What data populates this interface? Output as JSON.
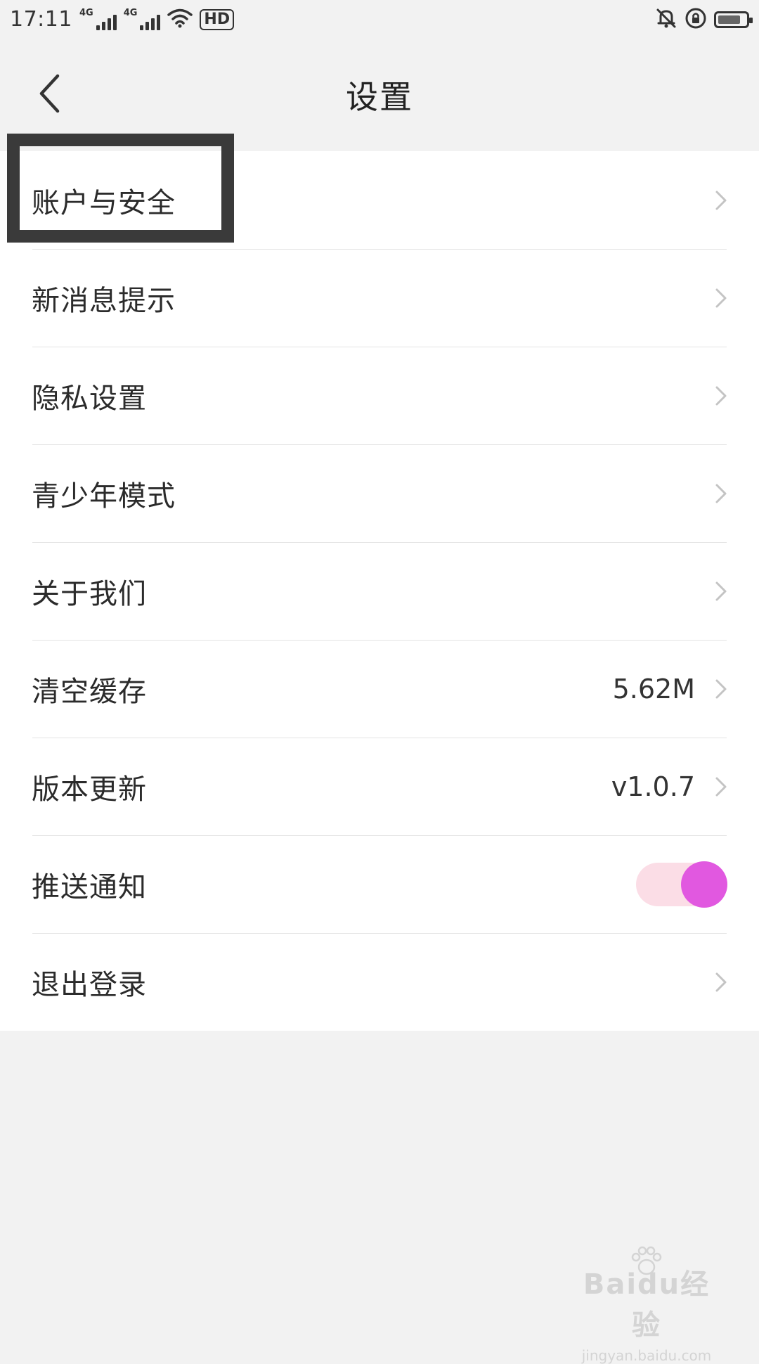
{
  "status_bar": {
    "time": "17:11",
    "network_1": "4G",
    "network_2": "4G",
    "hd_label": "HD",
    "battery_level": 0.7
  },
  "header": {
    "title": "设置",
    "back_icon": "chevron-left-icon"
  },
  "settings": {
    "items": [
      {
        "label": "账户与安全",
        "value": "",
        "type": "link"
      },
      {
        "label": "新消息提示",
        "value": "",
        "type": "link"
      },
      {
        "label": "隐私设置",
        "value": "",
        "type": "link"
      },
      {
        "label": "青少年模式",
        "value": "",
        "type": "link"
      },
      {
        "label": "关于我们",
        "value": "",
        "type": "link"
      },
      {
        "label": "清空缓存",
        "value": "5.62M",
        "type": "link"
      },
      {
        "label": "版本更新",
        "value": "v1.0.7",
        "type": "link"
      },
      {
        "label": "推送通知",
        "value": "",
        "type": "toggle",
        "on": true
      },
      {
        "label": "退出登录",
        "value": "",
        "type": "link"
      }
    ]
  },
  "colors": {
    "page_background": "#f2f2f2",
    "list_background": "#ffffff",
    "toggle_track": "#fbdde6",
    "toggle_knob": "#e158e0",
    "highlight_border": "#3a3a3a"
  },
  "watermark": {
    "logo_text": "Baidu经验",
    "url": "jingyan.baidu.com"
  }
}
